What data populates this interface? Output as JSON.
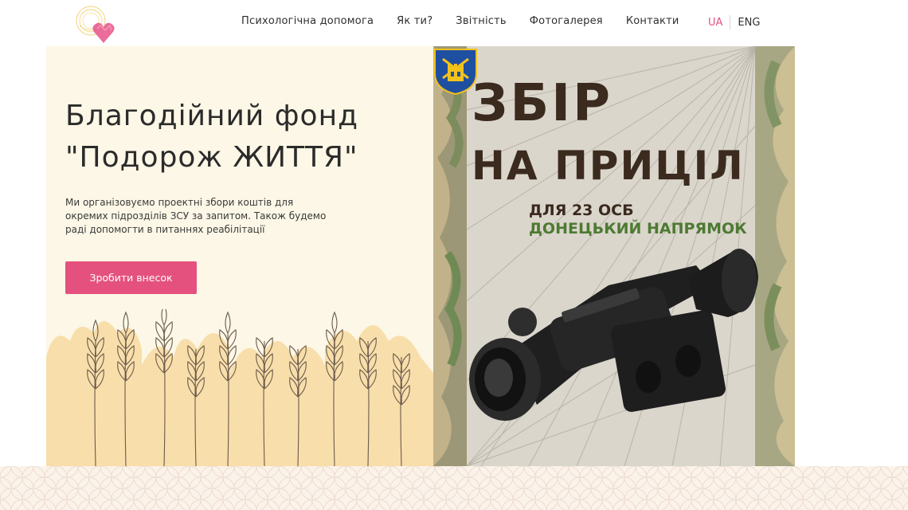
{
  "header": {
    "logo_name": "heart-logo",
    "nav": [
      "Психологічна допомога",
      "Як ти?",
      "Звітність",
      "Фотогалерея",
      "Контакти"
    ],
    "lang_ua": "UA",
    "lang_eng": "ENG",
    "lang_active_color": "#e4517f"
  },
  "hero": {
    "title_line1": "Благодійний фонд",
    "title_line2": "\"Подорож ЖИТТЯ\"",
    "description": "Ми організовуємо проектні збори коштів для окремих підрозділів ЗСУ за запитом. Також будемо раді допомогти в питаннях реабілітації",
    "cta_label": "Зробити внесок",
    "cta_color": "#e4517f",
    "background": "#fcf7e6"
  },
  "banner": {
    "title_line1": "ЗБІР",
    "title_line2": "НА ПРИЦІЛ",
    "brigade": "ДЛЯ 23 ОСБ",
    "direction": "ДОНЕЦЬКИЙ НАПРЯМОК",
    "emblem_icon": "brigade-shield-icon",
    "product_icon": "thermal-scope-image",
    "title_color": "#3b2a1e",
    "direction_color": "#4d7a32"
  }
}
